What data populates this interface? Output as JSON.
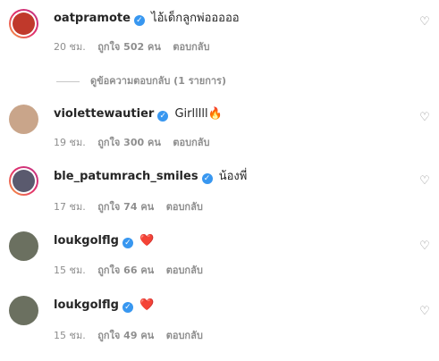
{
  "comments": [
    {
      "username": "oatpramote",
      "text": "ไอ้เด็กลูกพ่อออออ",
      "time": "20 ชม.",
      "likes": "ถูกใจ 502 คน",
      "reply": "ตอบกลับ",
      "avatar_color": "#c0392b"
    },
    {
      "username": "violettewautier",
      "text": "Girlllll",
      "emoji": "🔥",
      "time": "19 ชม.",
      "likes": "ถูกใจ 300 คน",
      "reply": "ตอบกลับ",
      "avatar_color": "#c9a58a"
    },
    {
      "username": "ble_patumrach_smiles",
      "text": "น้องพี่",
      "time": "17 ชม.",
      "likes": "ถูกใจ 74 คน",
      "reply": "ตอบกลับ",
      "avatar_color": "#5a5a6e"
    },
    {
      "username": "loukgolflg",
      "text": "",
      "emoji": "❤️",
      "time": "15 ชม.",
      "likes": "ถูกใจ 66 คน",
      "reply": "ตอบกลับ",
      "avatar_color": "#6b7060"
    },
    {
      "username": "loukgolflg",
      "text": "",
      "emoji": "❤️",
      "time": "15 ชม.",
      "likes": "ถูกใจ 49 คน",
      "reply": "ตอบกลับ",
      "avatar_color": "#6b7060"
    }
  ],
  "view_replies": "ดูข้อความตอบกลับ (1 รายการ)",
  "colors": {
    "verified": "#3897f0",
    "muted": "#8e8e8e",
    "text": "#262626"
  }
}
